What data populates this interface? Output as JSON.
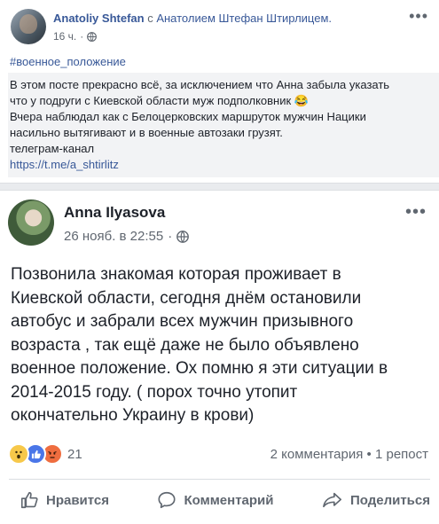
{
  "post_top": {
    "author": "Anatoliy Shtefan",
    "with_word": "с",
    "tagged": "Анатолием Штефан Штирлицем.",
    "time": "16 ч.",
    "privacy_icon": "globe-icon",
    "more_icon": "more-icon",
    "hashtag": "#военное_положение",
    "lines": [
      "В этом посте прекрасно всё, за исключением что Анна забыла указать",
      "что у подруги с Киевской области муж подполковник 😂",
      "Вчера наблюдал как с Белоцерковских маршруток мужчин Нацики",
      "насильно вытягивают и в военные автозаки грузят.",
      "телеграм-канал"
    ],
    "link": "https://t.me/a_shtirlitz"
  },
  "shared_post": {
    "author": "Anna Ilyasova",
    "time": "26 нояб. в 22:55",
    "privacy_icon": "globe-icon",
    "more_icon": "more-icon",
    "lines": [
      "Позвонила знакомая которая проживает в",
      "Киевской области, сегодня днём остановили",
      "автобус и забрали всех мужчин призывного",
      "возраста , так ещё даже не было объявлено",
      "военное положение. Ох помню я эти ситуации в",
      "2014-2015 году. ( порох точно утопит",
      "окончательно Украину в крови)"
    ]
  },
  "reactions": {
    "icons": [
      "wow-icon",
      "like-icon",
      "angry-icon"
    ],
    "count": "21",
    "comments": "2 комментария",
    "separator": "•",
    "shares": "1 репост",
    "colors": {
      "wow": "#f7c84a",
      "like": "#4a76e8",
      "angry": "#ef6d3f"
    }
  },
  "actions": {
    "like": "Нравится",
    "comment": "Комментарий",
    "share": "Поделиться"
  },
  "colors": {
    "link": "#385898",
    "secondary": "#606770",
    "quote_bg": "#f2f3f5",
    "separator": "#e9ebee"
  }
}
